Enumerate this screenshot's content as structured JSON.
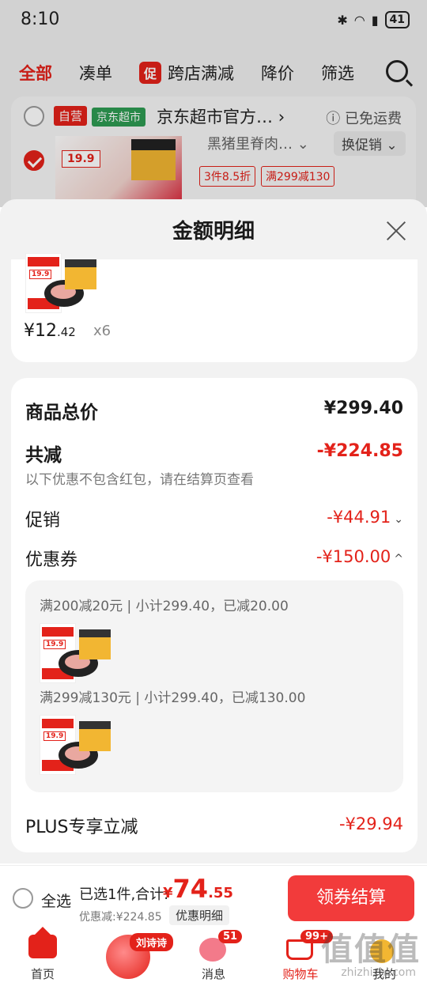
{
  "status": {
    "time": "8:10",
    "battery": "41"
  },
  "filters": {
    "all": "全部",
    "combine": "凑单",
    "promo_badge": "促",
    "cross_store": "跨店满减",
    "price_drop": "降价",
    "filter": "筛选"
  },
  "store": {
    "tag_self": "自营",
    "tag_market": "京东超市",
    "name": "京东超市官方…",
    "arrow": "›",
    "shipping": "ⓘ 已免运费",
    "product_name": "黑猪里脊肉…",
    "swap_promo": "换促销",
    "thumb_price": "19.9",
    "promo_tags": [
      "3件8.5折",
      "满299减130"
    ]
  },
  "sheet": {
    "title": "金额明细",
    "unit_price_int": "¥12",
    "unit_price_dec": ".42",
    "qty": "x6",
    "goods_total_label": "商品总价",
    "goods_total_value": "¥299.40",
    "discount_label": "共减",
    "discount_value": "-¥224.85",
    "discount_note": "以下优惠不包含红包，请在结算页查看",
    "promo_label": "促销",
    "promo_value": "-¥44.91",
    "coupon_label": "优惠券",
    "coupon_value": "-¥150.00",
    "coupon_lines": [
      "满200减20元 | 小计299.40，已减20.00",
      "满299减130元 | 小计299.40，已减130.00"
    ],
    "plus_label": "PLUS专享立减",
    "plus_value": "-¥29.94",
    "mini_price": "19.9"
  },
  "checkout": {
    "select_all": "全选",
    "selected_text": "已选1件,合计:",
    "total_currency": "¥",
    "total_int": "74",
    "total_dec": ".55",
    "saved_text": "优惠减:¥224.85",
    "detail_link": "优惠明细",
    "checkout_button": "领券结算"
  },
  "tabbar": {
    "home": "首页",
    "mascot_tag": "刘诗诗",
    "messages": "消息",
    "messages_badge": "51",
    "cart": "购物车",
    "cart_badge": "99+",
    "me": "我的"
  },
  "watermark": {
    "big": "值值值",
    "small": "zhizhizhi.com"
  },
  "colors": {
    "brand_red": "#e3221a",
    "button_red": "#f23b3b",
    "market_green": "#2e9b52"
  }
}
